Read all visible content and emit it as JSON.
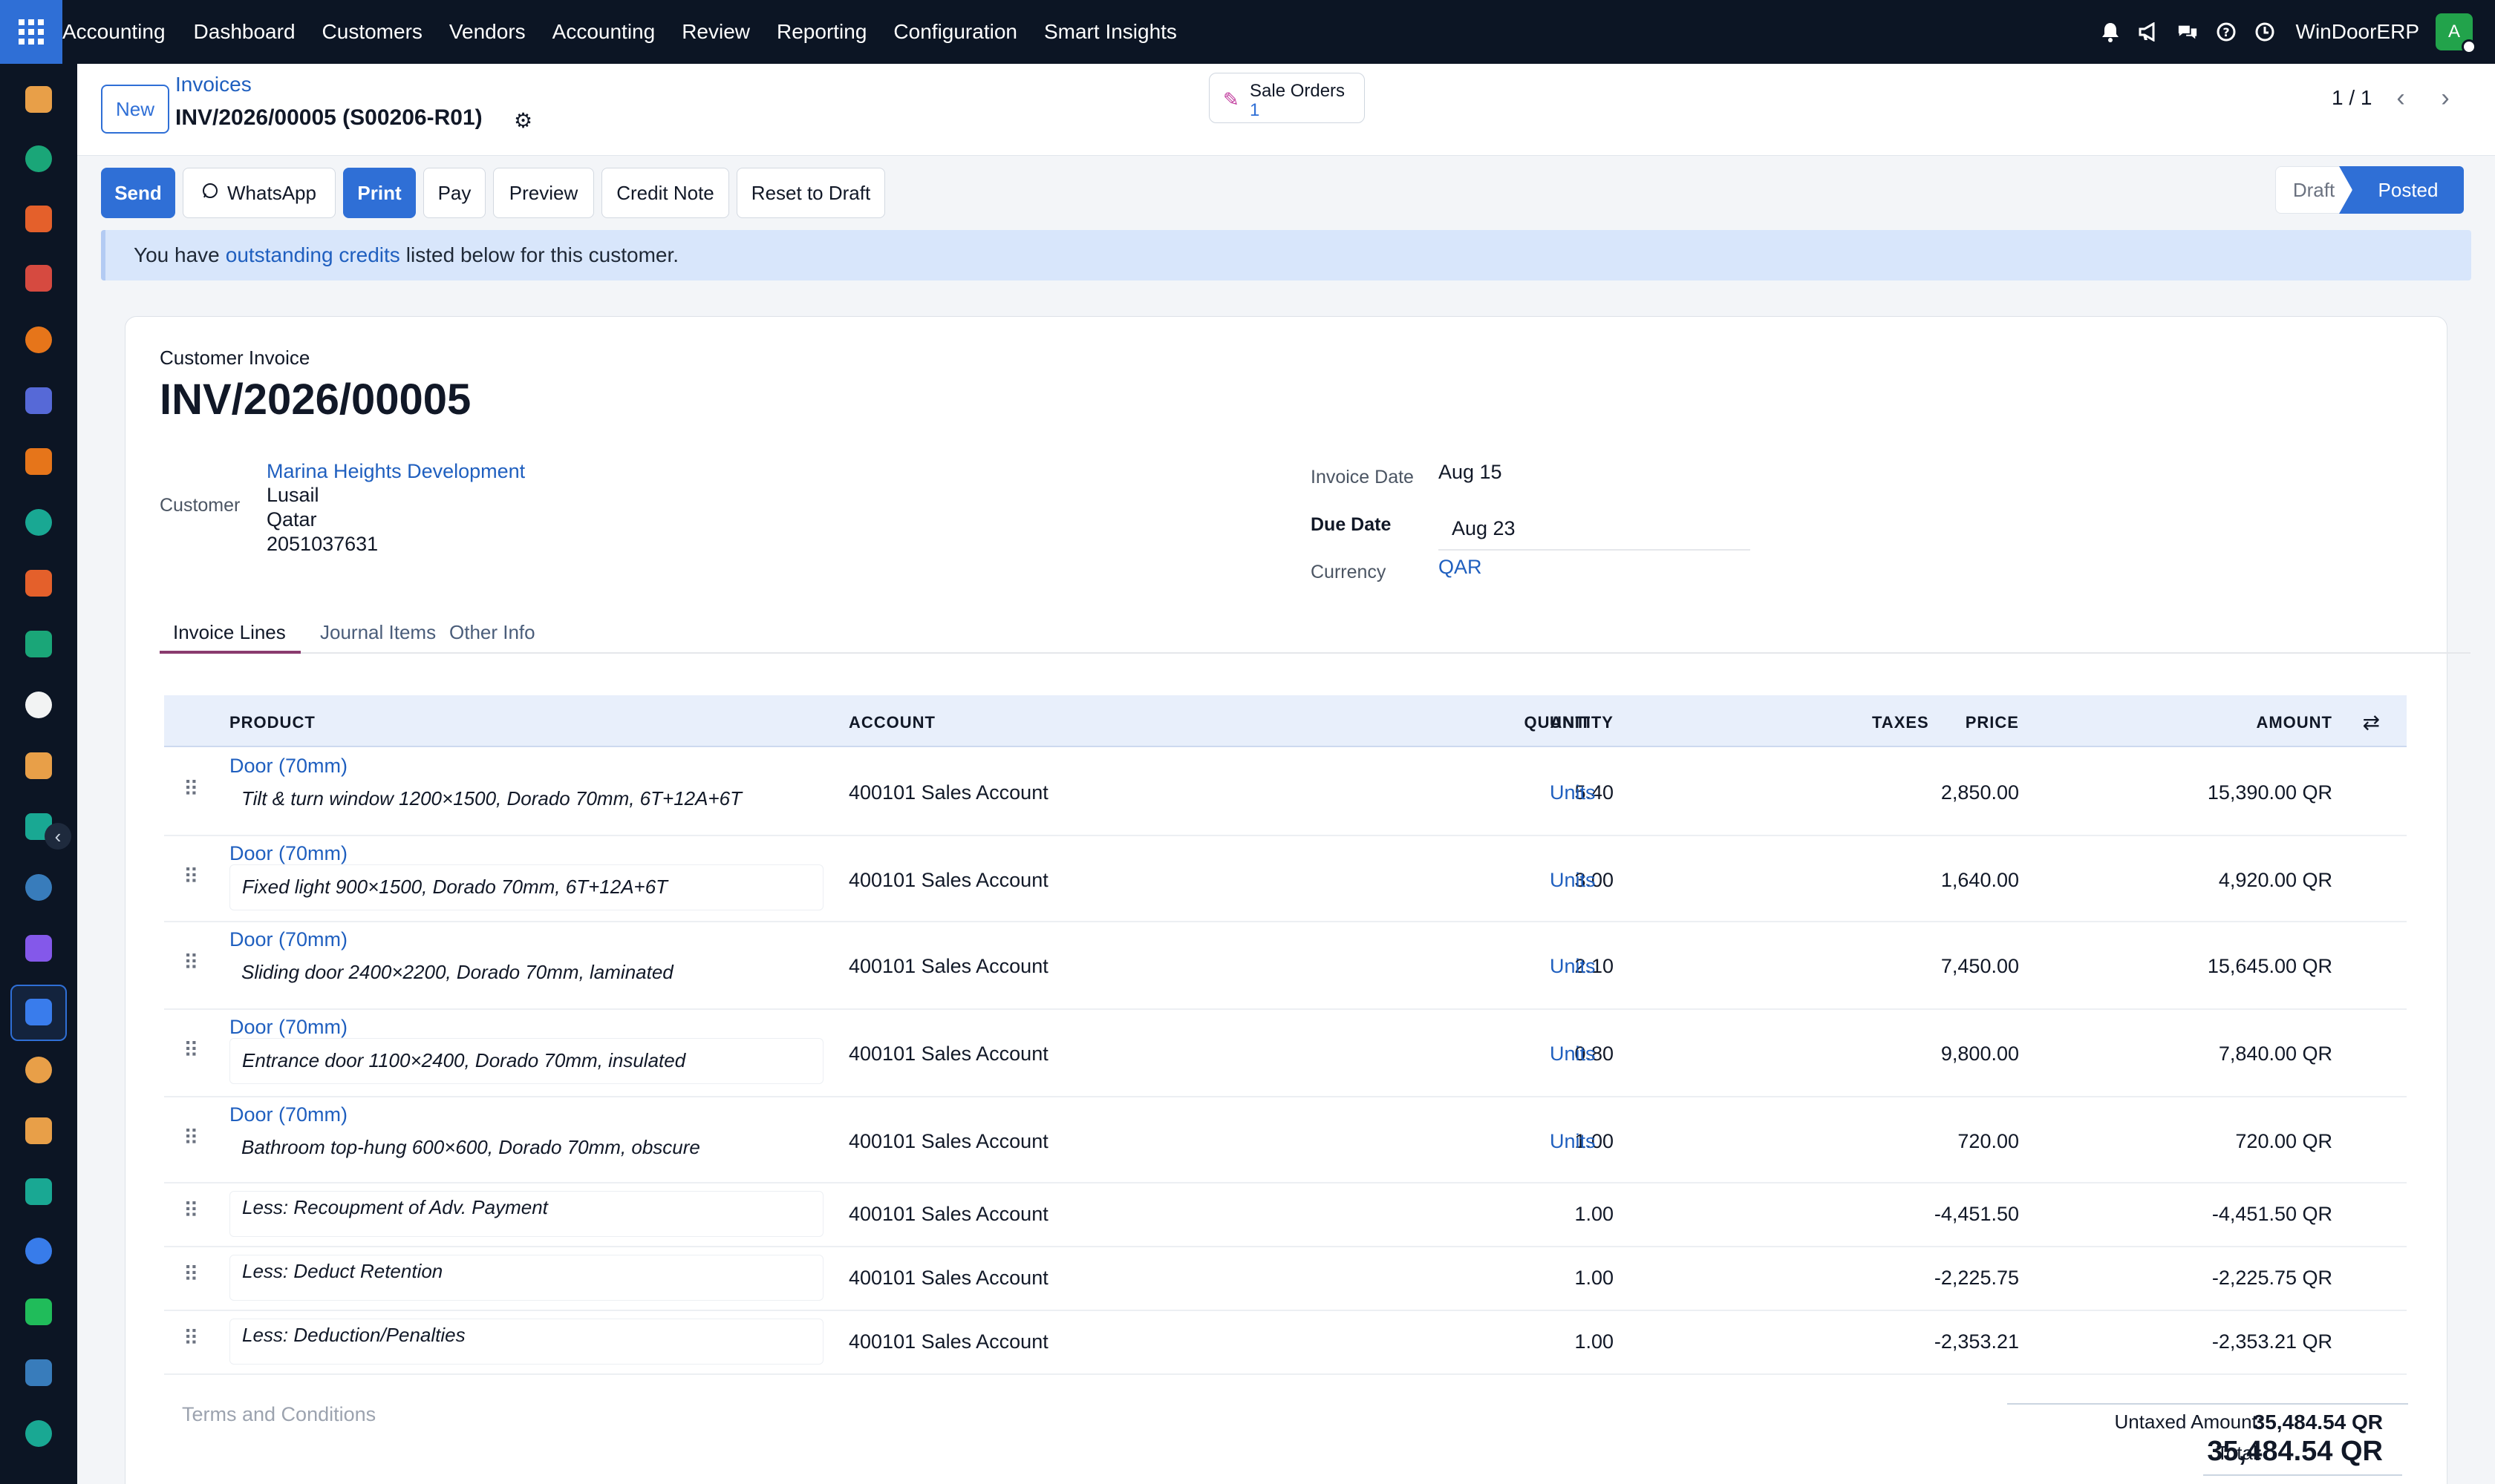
{
  "topbar": {
    "app_name": "Accounting",
    "menu": [
      "Dashboard",
      "Customers",
      "Vendors",
      "Accounting",
      "Review",
      "Reporting",
      "Configuration",
      "Smart Insights"
    ],
    "company": "WinDoorERP",
    "avatar_letter": "A"
  },
  "sidebar": {
    "apps": [
      {
        "icon": "discuss-app-icon",
        "color": "#f4a64b"
      },
      {
        "icon": "contacts-app-icon",
        "color": "#1bae7d"
      },
      {
        "icon": "reporting-app-icon",
        "color": "#f0642c"
      },
      {
        "icon": "dashboard-app-icon",
        "color": "#e24d42"
      },
      {
        "icon": "chat-app-icon",
        "color": "#f27a1a"
      },
      {
        "icon": "email-marketing-app-icon",
        "color": "#5b6ee1"
      },
      {
        "icon": "livechat-app-icon",
        "color": "#f27a1a"
      },
      {
        "icon": "project-app-icon",
        "color": "#1ab09a"
      },
      {
        "icon": "spreadsheet-app-icon",
        "color": "#f0642c"
      },
      {
        "icon": "employees-app-icon",
        "color": "#1bae7d"
      },
      {
        "icon": "inventory-app-icon",
        "color": "#ffffff"
      },
      {
        "icon": "planning-app-icon",
        "color": "#f4a64b"
      },
      {
        "icon": "todo-app-icon",
        "color": "#1ab09a"
      },
      {
        "icon": "knowledge-app-icon",
        "color": "#3b82c4"
      },
      {
        "icon": "manufacturing-app-icon",
        "color": "#8b5cf6"
      },
      {
        "icon": "invoicing-app-icon",
        "color": "#3b82f6"
      },
      {
        "icon": "team-app-icon",
        "color": "#f4a64b"
      },
      {
        "icon": "calendar-app-icon",
        "color": "#f4a64b"
      },
      {
        "icon": "sign-app-icon",
        "color": "#1ab09a"
      },
      {
        "icon": "apps-app-icon",
        "color": "#3b82f6"
      },
      {
        "icon": "whatsapp-app-icon",
        "color": "#22c55e"
      },
      {
        "icon": "timesheets-app-icon",
        "color": "#3b82c4"
      },
      {
        "icon": "website-app-icon",
        "color": "#1ab09a"
      }
    ]
  },
  "control": {
    "new_label": "New",
    "breadcrumb": "Invoices",
    "record_title": "INV/2026/00005 (S00206-R01)",
    "smart_button": {
      "label": "Sale Orders",
      "count": "1"
    },
    "pager": "1 / 1"
  },
  "actions": [
    "Send",
    "WhatsApp",
    "Print",
    "Pay",
    "Preview",
    "Credit Note",
    "Reset to Draft"
  ],
  "statusbar": {
    "draft": "Draft",
    "posted": "Posted"
  },
  "alert": {
    "before": "You have",
    "link": "outstanding credits",
    "after": "listed below for this customer."
  },
  "invoice": {
    "type": "Customer Invoice",
    "name": "INV/2026/00005",
    "customer_label": "Customer",
    "customer_name": "Marina Heights Development",
    "customer_city": "Lusail",
    "customer_country": "Qatar",
    "customer_phone": "2051037631",
    "invoice_date_label": "Invoice Date",
    "invoice_date": "Aug 15",
    "due_date_label": "Due Date",
    "due_date": "Aug 23",
    "currency_label": "Currency",
    "currency": "QAR"
  },
  "tabs": [
    "Invoice Lines",
    "Journal Items",
    "Other Info"
  ],
  "lines": {
    "headers": {
      "product": "PRODUCT",
      "account": "ACCOUNT",
      "quantity": "QUANTITY",
      "unit": "UNIT",
      "price": "PRICE",
      "taxes": "TAXES",
      "amount": "AMOUNT"
    },
    "rows": [
      {
        "product": "Door (70mm)",
        "description": "Tilt & turn window 1200×1500, Dorado 70mm, 6T+12A+6T",
        "account": "400101 Sales Account",
        "quantity": "5.40",
        "unit": "Units",
        "price": "2,850.00",
        "amount": "15,390.00 QR"
      },
      {
        "product": "Door (70mm)",
        "description": "Fixed light 900×1500, Dorado 70mm, 6T+12A+6T",
        "account": "400101 Sales Account",
        "quantity": "3.00",
        "unit": "Units",
        "price": "1,640.00",
        "amount": "4,920.00 QR"
      },
      {
        "product": "Door (70mm)",
        "description": "Sliding door 2400×2200, Dorado 70mm, laminated",
        "account": "400101 Sales Account",
        "quantity": "2.10",
        "unit": "Units",
        "price": "7,450.00",
        "amount": "15,645.00 QR"
      },
      {
        "product": "Door (70mm)",
        "description": "Entrance door 1100×2400, Dorado 70mm, insulated",
        "account": "400101 Sales Account",
        "quantity": "0.80",
        "unit": "Units",
        "price": "9,800.00",
        "amount": "7,840.00 QR"
      },
      {
        "product": "Door (70mm)",
        "description": "Bathroom top-hung 600×600, Dorado 70mm, obscure",
        "account": "400101 Sales Account",
        "quantity": "1.00",
        "unit": "Units",
        "price": "720.00",
        "amount": "720.00 QR"
      },
      {
        "product": "",
        "description": "Less: Recoupment of Adv. Payment",
        "account": "400101 Sales Account",
        "quantity": "1.00",
        "unit": "",
        "price": "-4,451.50",
        "amount": "-4,451.50 QR"
      },
      {
        "product": "",
        "description": "Less: Deduct Retention",
        "account": "400101 Sales Account",
        "quantity": "1.00",
        "unit": "",
        "price": "-2,225.75",
        "amount": "-2,225.75 QR"
      },
      {
        "product": "",
        "description": "Less: Deduction/Penalties",
        "account": "400101 Sales Account",
        "quantity": "1.00",
        "unit": "",
        "price": "-2,353.21",
        "amount": "-2,353.21 QR"
      }
    ]
  },
  "footer": {
    "terms_placeholder": "Terms and Conditions",
    "untaxed_label": "Untaxed Amount:",
    "untaxed_value": "35,484.54 QR",
    "total_label": "Total:",
    "total_value": "35,484.54 QR"
  },
  "colors": {
    "accent": "#2f6fd6",
    "topbar": "#0c1524",
    "link": "#1f5fbf",
    "tab_underline": "#8a3b6e"
  }
}
